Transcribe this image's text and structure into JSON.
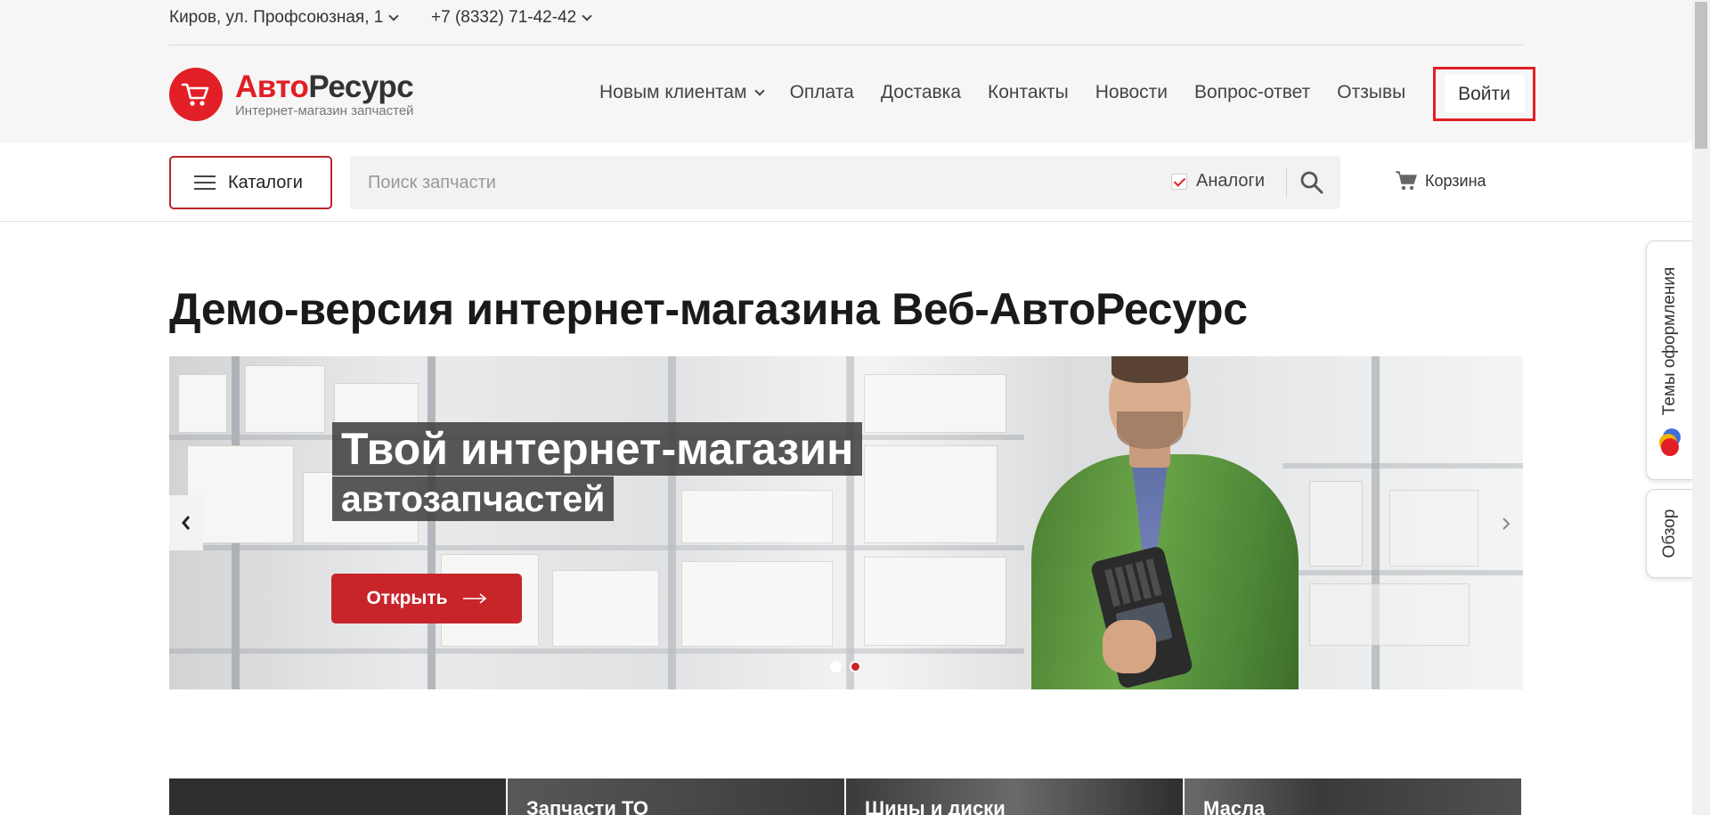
{
  "topbar": {
    "address": "Киров, ул. Профсоюзная, 1",
    "phone": "+7 (8332) 71-42-42"
  },
  "logo": {
    "name_part1": "Авто",
    "name_part2": "Ресурс",
    "subtitle": "Интернет-магазин запчастей",
    "icon": "cart-icon"
  },
  "nav": {
    "items": [
      {
        "label": "Новым клиентам",
        "has_dropdown": true
      },
      {
        "label": "Оплата"
      },
      {
        "label": "Доставка"
      },
      {
        "label": "Контакты"
      },
      {
        "label": "Новости"
      },
      {
        "label": "Вопрос-ответ"
      },
      {
        "label": "Отзывы"
      }
    ],
    "login_label": "Войти"
  },
  "search": {
    "catalog_label": "Каталоги",
    "placeholder": "Поиск запчасти",
    "analogs_label": "Аналоги",
    "analogs_checked": true,
    "cart_label": "Корзина"
  },
  "page": {
    "title": "Демо-версия интернет-магазина Веб-АвтоРесурс"
  },
  "banner": {
    "line1": "Твой интернет-магазин",
    "line2": "автозапчастей",
    "button_label": "Открыть",
    "slides_total": 2,
    "active_slide": 2
  },
  "tiles": [
    {
      "label": ""
    },
    {
      "label": "Запчасти ТО"
    },
    {
      "label": "Шины и диски"
    },
    {
      "label": "Масла"
    }
  ],
  "side_tabs": {
    "themes_label": "Темы оформления",
    "overview_label": "Обзор"
  },
  "colors": {
    "brand_red": "#e21f26",
    "button_red": "#c8252b",
    "header_bg": "#f6f6f6"
  }
}
